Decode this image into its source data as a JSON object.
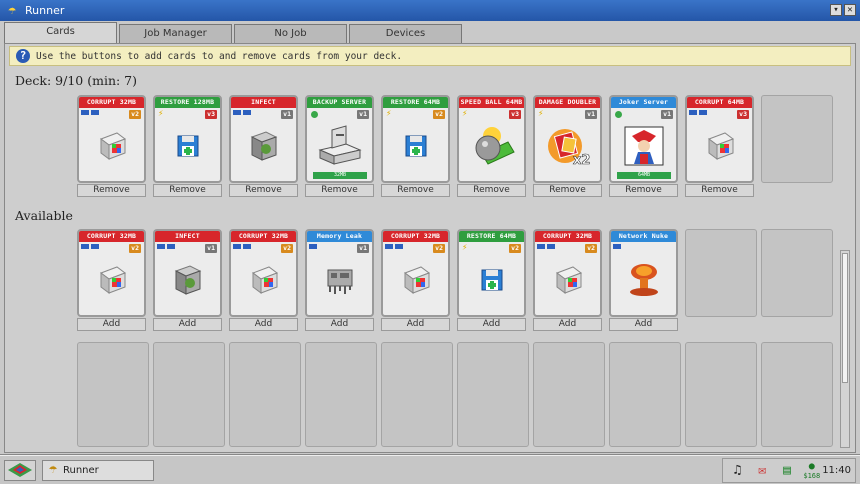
{
  "window": {
    "title": "Runner",
    "minimize_label": "▾",
    "close_label": "✕"
  },
  "tabs": [
    {
      "label": "Cards"
    },
    {
      "label": "Job Manager"
    },
    {
      "label": "No Job"
    },
    {
      "label": "Devices"
    }
  ],
  "info": {
    "icon": "?",
    "text": "Use the buttons to add cards to and remove cards from your deck."
  },
  "deck": {
    "title": "Deck: 9/10 (min: 7)",
    "button_label": "Remove",
    "cards": [
      {
        "label": "CORRUPT 32MB",
        "color": "red",
        "pips": 2,
        "badge": "v2",
        "badge_color": "orange",
        "art": "corrupt-icon"
      },
      {
        "label": "RESTORE 128MB",
        "color": "green",
        "pips": 0,
        "badge": "v3",
        "badge_color": "red",
        "art": "restore-icon",
        "bolt": true
      },
      {
        "label": "INFECT",
        "color": "red",
        "pips": 2,
        "badge": "v1",
        "badge_color": "gray",
        "art": "infect-icon"
      },
      {
        "label": "BACKUP SERVER",
        "color": "green",
        "pips": 0,
        "badge": "v1",
        "badge_color": "gray",
        "art": "backup-server-icon",
        "dot": true,
        "sub": "32MB"
      },
      {
        "label": "RESTORE 64MB",
        "color": "green",
        "pips": 0,
        "badge": "v2",
        "badge_color": "orange",
        "art": "restore-icon",
        "bolt": true
      },
      {
        "label": "SPEED BALL 64MB",
        "color": "red",
        "pips": 0,
        "badge": "v3",
        "badge_color": "red",
        "art": "speed-ball-icon",
        "bolt": true
      },
      {
        "label": "DAMAGE DOUBLER",
        "color": "red",
        "pips": 0,
        "badge": "v1",
        "badge_color": "gray",
        "art": "damage-doubler-icon",
        "bolt": true
      },
      {
        "label": "Joker Server",
        "color": "blue",
        "pips": 0,
        "badge": "v1",
        "badge_color": "gray",
        "art": "joker-icon",
        "dot": true,
        "sub": "64MB"
      },
      {
        "label": "CORRUPT 64MB",
        "color": "red",
        "pips": 2,
        "badge": "v3",
        "badge_color": "red",
        "art": "corrupt-icon"
      }
    ]
  },
  "available": {
    "title": "Available",
    "button_label": "Add",
    "cards": [
      {
        "label": "CORRUPT 32MB",
        "color": "red",
        "pips": 2,
        "badge": "v2",
        "badge_color": "orange",
        "art": "corrupt-icon"
      },
      {
        "label": "INFECT",
        "color": "red",
        "pips": 2,
        "badge": "v1",
        "badge_color": "gray",
        "art": "infect-icon"
      },
      {
        "label": "CORRUPT 32MB",
        "color": "red",
        "pips": 2,
        "badge": "v2",
        "badge_color": "orange",
        "art": "corrupt-icon"
      },
      {
        "label": "Memory Leak",
        "color": "blue",
        "pips": 1,
        "badge": "v1",
        "badge_color": "gray",
        "art": "memory-leak-icon"
      },
      {
        "label": "CORRUPT 32MB",
        "color": "red",
        "pips": 2,
        "badge": "v2",
        "badge_color": "orange",
        "art": "corrupt-icon"
      },
      {
        "label": "RESTORE 64MB",
        "color": "green",
        "pips": 0,
        "badge": "v2",
        "badge_color": "orange",
        "art": "restore-icon",
        "bolt": true
      },
      {
        "label": "CORRUPT 32MB",
        "color": "red",
        "pips": 2,
        "badge": "v2",
        "badge_color": "orange",
        "art": "corrupt-icon"
      },
      {
        "label": "Network Nuke",
        "color": "blue",
        "pips": 1,
        "badge": "",
        "badge_color": "gray",
        "art": "network-nuke-icon"
      }
    ]
  },
  "taskbar": {
    "task_label": "Runner",
    "money": "$168",
    "clock": "11:40"
  }
}
